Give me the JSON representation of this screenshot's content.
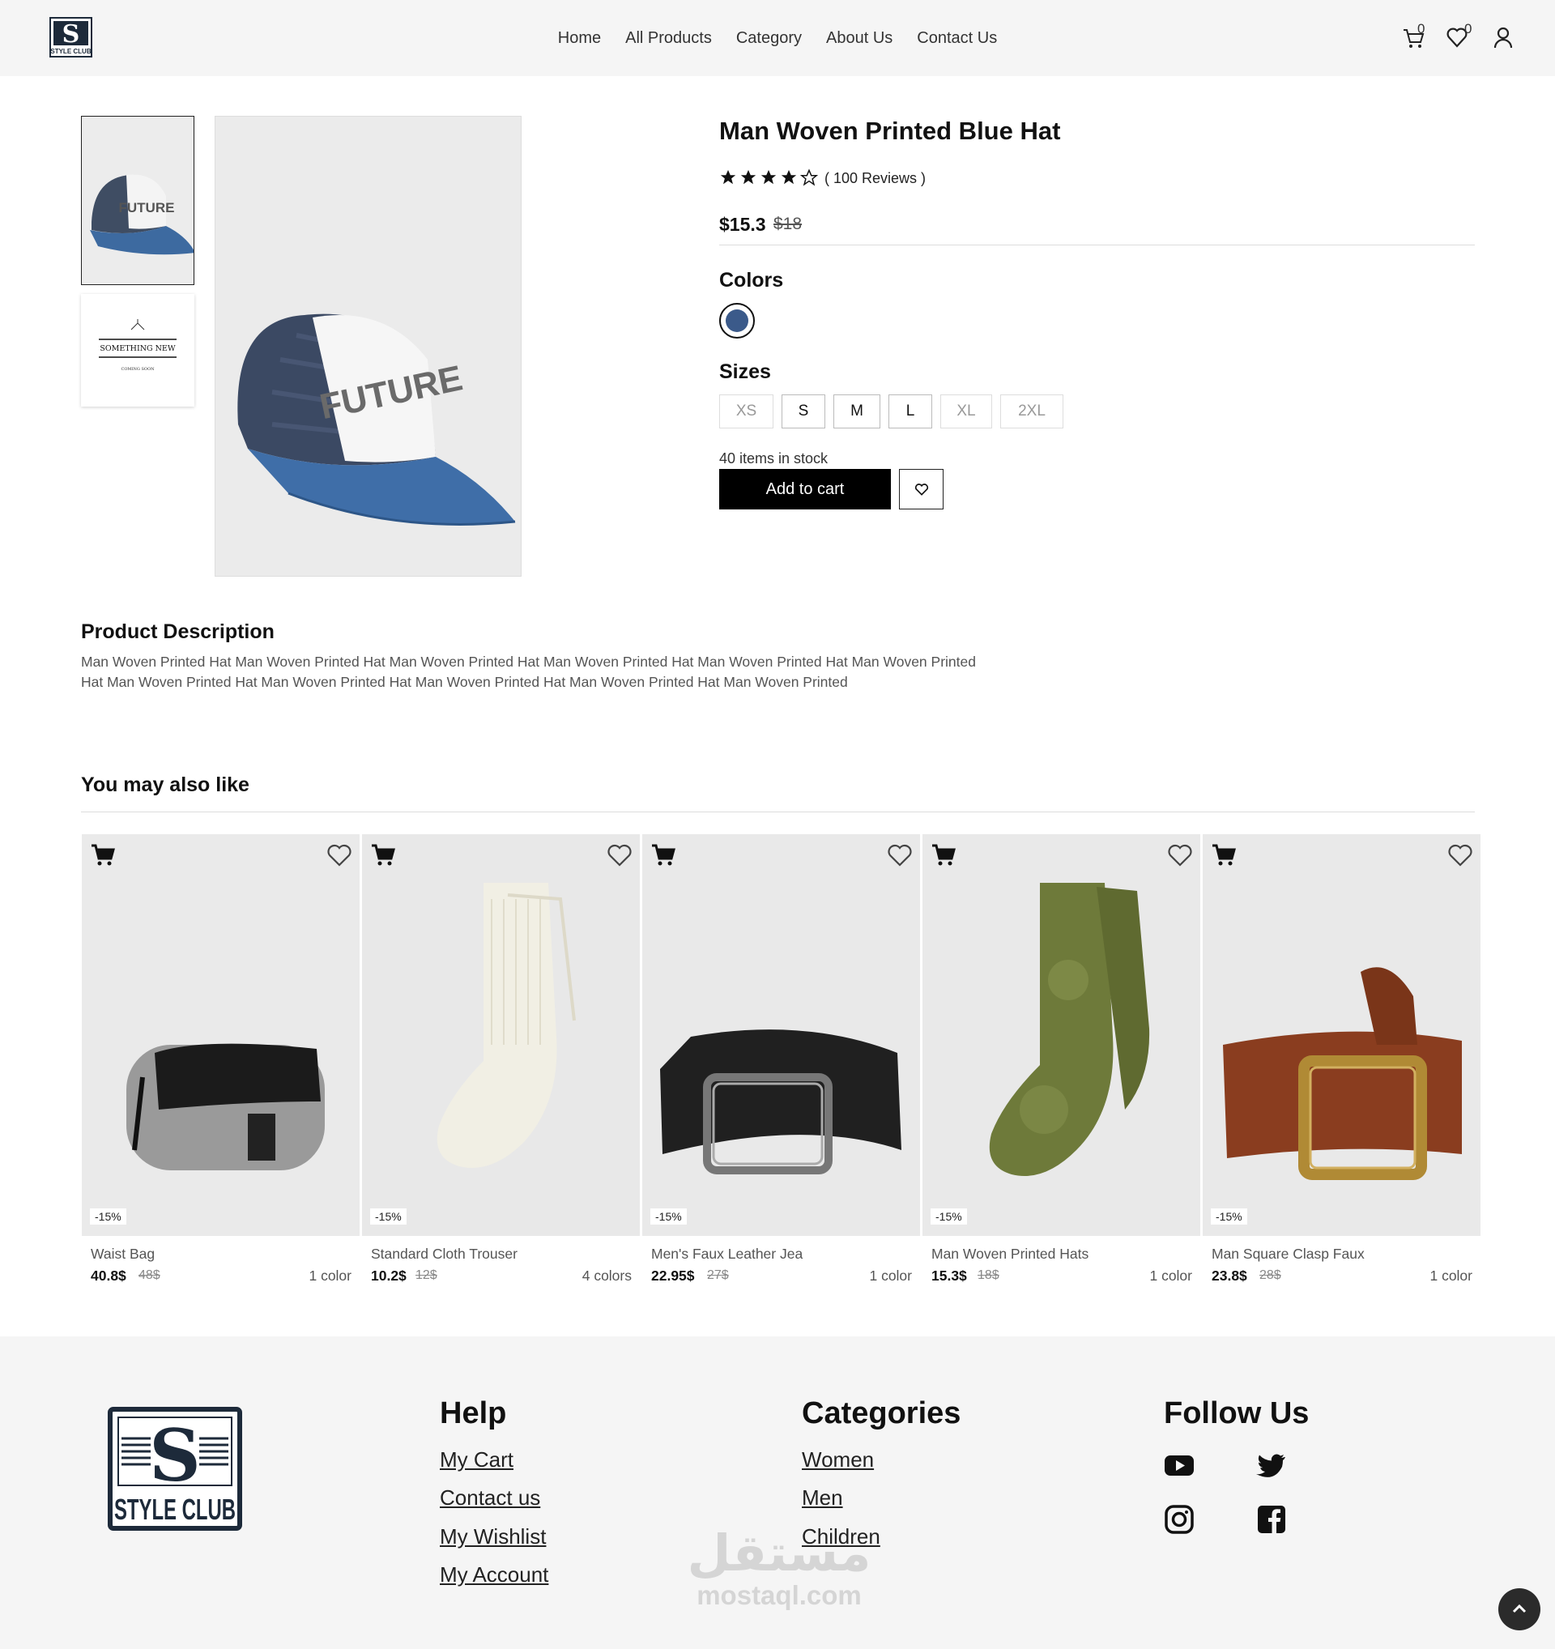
{
  "header": {
    "logo_text": "STYLE CLUB",
    "nav": [
      "Home",
      "All Products",
      "Category",
      "About Us",
      "Contact Us"
    ],
    "cart_count": "0",
    "wishlist_count": "0"
  },
  "product": {
    "title": "Man Woven Printed Blue Hat",
    "rating": 4,
    "rating_max": 5,
    "reviews": "( 100 Reviews )",
    "price": "$15.3",
    "old_price": "$18",
    "colors_label": "Colors",
    "colors": [
      "#3b5a8a"
    ],
    "sizes_label": "Sizes",
    "sizes": [
      {
        "label": "XS",
        "available": false
      },
      {
        "label": "S",
        "available": true
      },
      {
        "label": "M",
        "available": true
      },
      {
        "label": "L",
        "available": true
      },
      {
        "label": "XL",
        "available": false
      },
      {
        "label": "2XL",
        "available": false
      }
    ],
    "stock": "40 items in stock",
    "add_to_cart": "Add to cart",
    "thumb_text_1": "FUTURE",
    "thumb_text_2": "SOMETHING NEW",
    "thumb_text_3": "COMING SOON",
    "image_text": "FUTURE"
  },
  "description": {
    "title": "Product Description",
    "text": "Man Woven Printed Hat Man Woven Printed Hat Man Woven Printed Hat Man Woven Printed Hat Man Woven Printed Hat Man Woven Printed Hat Man Woven Printed Hat Man Woven Printed Hat Man Woven Printed Hat Man Woven Printed Hat Man Woven Printed"
  },
  "related": {
    "title": "You may also like",
    "items": [
      {
        "name": "Waist Bag",
        "price": "40.8$",
        "old": "48$",
        "colors": "1 color",
        "discount": "-15%",
        "img": "bag"
      },
      {
        "name": "Standard Cloth Trouser",
        "price": "10.2$",
        "old": "12$",
        "colors": "4 colors",
        "discount": "-15%",
        "img": "sock-white"
      },
      {
        "name": "Men's Faux Leather Jea",
        "price": "22.95$",
        "old": "27$",
        "colors": "1 color",
        "discount": "-15%",
        "img": "belt-black"
      },
      {
        "name": "Man Woven Printed Hats",
        "price": "15.3$",
        "old": "18$",
        "colors": "1 color",
        "discount": "-15%",
        "img": "sock-green"
      },
      {
        "name": "Man Square Clasp Faux",
        "price": "23.8$",
        "old": "28$",
        "colors": "1 color",
        "discount": "-15%",
        "img": "belt-brown"
      }
    ]
  },
  "footer": {
    "logo_text": "STYLE CLUB",
    "help_title": "Help",
    "help_links": [
      "My Cart",
      "Contact us",
      "My Wishlist",
      "My Account"
    ],
    "categories_title": "Categories",
    "category_links": [
      "Women",
      "Men",
      "Children"
    ],
    "follow_title": "Follow Us",
    "socials": [
      "youtube-icon",
      "twitter-icon",
      "instagram-icon",
      "facebook-icon"
    ],
    "watermark_ar": "مستقل",
    "watermark_en": "mostaql.com"
  }
}
